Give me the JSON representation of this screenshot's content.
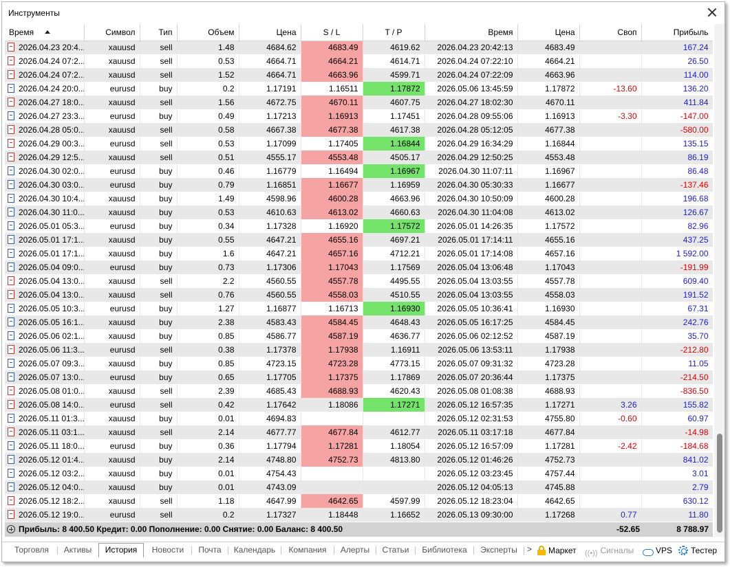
{
  "window": {
    "title": "Инструменты"
  },
  "columns": [
    "Время",
    "Символ",
    "Тип",
    "Объем",
    "Цена",
    "S / L",
    "T / P",
    "Время",
    "Цена",
    "Своп",
    "Прибыль"
  ],
  "rows": [
    {
      "open_time": "2026.04.23 20:4...",
      "symbol": "xauusd",
      "type": "sell",
      "volume": "1.48",
      "price": "4684.62",
      "sl": "4683.49",
      "tp": "4619.62",
      "close_time": "2026.04.23 20:42:13",
      "close_price": "4683.49",
      "swap": "",
      "profit": "167.24",
      "hit": "sl"
    },
    {
      "open_time": "2026.04.24 07:2...",
      "symbol": "xauusd",
      "type": "sell",
      "volume": "0.53",
      "price": "4664.71",
      "sl": "4664.21",
      "tp": "4614.71",
      "close_time": "2026.04.24 07:22:10",
      "close_price": "4664.21",
      "swap": "",
      "profit": "26.50",
      "hit": "sl"
    },
    {
      "open_time": "2026.04.24 07:2...",
      "symbol": "xauusd",
      "type": "sell",
      "volume": "1.52",
      "price": "4664.71",
      "sl": "4663.96",
      "tp": "4599.71",
      "close_time": "2026.04.24 07:22:09",
      "close_price": "4663.96",
      "swap": "",
      "profit": "114.00",
      "hit": "sl"
    },
    {
      "open_time": "2026.04.24 20:0...",
      "symbol": "eurusd",
      "type": "buy",
      "volume": "0.2",
      "price": "1.17191",
      "sl": "1.16511",
      "tp": "1.17872",
      "close_time": "2026.05.06 13:45:59",
      "close_price": "1.17872",
      "swap": "-13.60",
      "profit": "136.20",
      "hit": "tp"
    },
    {
      "open_time": "2026.04.27 18:0...",
      "symbol": "xauusd",
      "type": "sell",
      "volume": "1.56",
      "price": "4672.75",
      "sl": "4670.11",
      "tp": "4607.75",
      "close_time": "2026.04.27 18:02:30",
      "close_price": "4670.11",
      "swap": "",
      "profit": "411.84",
      "hit": "sl"
    },
    {
      "open_time": "2026.04.27 23:3...",
      "symbol": "eurusd",
      "type": "buy",
      "volume": "0.49",
      "price": "1.17213",
      "sl": "1.16913",
      "tp": "1.17451",
      "close_time": "2026.04.28 09:55:06",
      "close_price": "1.16913",
      "swap": "-3.30",
      "profit": "-147.00",
      "hit": "sl"
    },
    {
      "open_time": "2026.04.28 05:0...",
      "symbol": "xauusd",
      "type": "sell",
      "volume": "0.58",
      "price": "4667.38",
      "sl": "4677.38",
      "tp": "4617.38",
      "close_time": "2026.04.28 05:12:05",
      "close_price": "4677.38",
      "swap": "",
      "profit": "-580.00",
      "hit": "sl"
    },
    {
      "open_time": "2026.04.29 00:3...",
      "symbol": "eurusd",
      "type": "sell",
      "volume": "0.53",
      "price": "1.17099",
      "sl": "1.17405",
      "tp": "1.16844",
      "close_time": "2026.04.29 16:34:29",
      "close_price": "1.16844",
      "swap": "",
      "profit": "135.15",
      "hit": "tp"
    },
    {
      "open_time": "2026.04.29 12:5...",
      "symbol": "xauusd",
      "type": "sell",
      "volume": "0.51",
      "price": "4555.17",
      "sl": "4553.48",
      "tp": "4505.17",
      "close_time": "2026.04.29 12:50:25",
      "close_price": "4553.48",
      "swap": "",
      "profit": "86.19",
      "hit": "sl"
    },
    {
      "open_time": "2026.04.30 02:0...",
      "symbol": "eurusd",
      "type": "buy",
      "volume": "0.46",
      "price": "1.16779",
      "sl": "1.16494",
      "tp": "1.16967",
      "close_time": "2026.04.30 11:07:11",
      "close_price": "1.16967",
      "swap": "",
      "profit": "86.48",
      "hit": "tp"
    },
    {
      "open_time": "2026.04.30 03:0...",
      "symbol": "eurusd",
      "type": "buy",
      "volume": "0.79",
      "price": "1.16851",
      "sl": "1.16677",
      "tp": "1.16959",
      "close_time": "2026.04.30 05:30:33",
      "close_price": "1.16677",
      "swap": "",
      "profit": "-137.46",
      "hit": "sl"
    },
    {
      "open_time": "2026.04.30 10:4...",
      "symbol": "xauusd",
      "type": "buy",
      "volume": "1.49",
      "price": "4598.96",
      "sl": "4600.28",
      "tp": "4663.96",
      "close_time": "2026.04.30 10:50:09",
      "close_price": "4600.28",
      "swap": "",
      "profit": "196.68",
      "hit": "sl"
    },
    {
      "open_time": "2026.04.30 11:0...",
      "symbol": "xauusd",
      "type": "buy",
      "volume": "0.53",
      "price": "4610.63",
      "sl": "4613.02",
      "tp": "4660.63",
      "close_time": "2026.04.30 11:04:08",
      "close_price": "4613.02",
      "swap": "",
      "profit": "126.67",
      "hit": "sl"
    },
    {
      "open_time": "2026.05.01 05:3...",
      "symbol": "eurusd",
      "type": "buy",
      "volume": "0.34",
      "price": "1.17328",
      "sl": "1.16920",
      "tp": "1.17572",
      "close_time": "2026.05.01 14:26:35",
      "close_price": "1.17572",
      "swap": "",
      "profit": "82.96",
      "hit": "tp"
    },
    {
      "open_time": "2026.05.01 17:1...",
      "symbol": "xauusd",
      "type": "buy",
      "volume": "0.55",
      "price": "4647.21",
      "sl": "4655.16",
      "tp": "4697.21",
      "close_time": "2026.05.01 17:14:11",
      "close_price": "4655.16",
      "swap": "",
      "profit": "437.25",
      "hit": "sl"
    },
    {
      "open_time": "2026.05.01 17:1...",
      "symbol": "xauusd",
      "type": "buy",
      "volume": "1.6",
      "price": "4647.21",
      "sl": "4657.16",
      "tp": "4712.21",
      "close_time": "2026.05.01 17:14:08",
      "close_price": "4657.16",
      "swap": "",
      "profit": "1 592.00",
      "hit": "sl"
    },
    {
      "open_time": "2026.05.04 09:0...",
      "symbol": "eurusd",
      "type": "buy",
      "volume": "0.73",
      "price": "1.17306",
      "sl": "1.17043",
      "tp": "1.17569",
      "close_time": "2026.05.04 13:06:48",
      "close_price": "1.17043",
      "swap": "",
      "profit": "-191.99",
      "hit": "sl"
    },
    {
      "open_time": "2026.05.04 13:0...",
      "symbol": "xauusd",
      "type": "sell",
      "volume": "2.2",
      "price": "4560.55",
      "sl": "4557.78",
      "tp": "4495.55",
      "close_time": "2026.05.04 13:03:55",
      "close_price": "4557.78",
      "swap": "",
      "profit": "609.40",
      "hit": "sl"
    },
    {
      "open_time": "2026.05.04 13:0...",
      "symbol": "xauusd",
      "type": "sell",
      "volume": "0.76",
      "price": "4560.55",
      "sl": "4558.03",
      "tp": "4510.55",
      "close_time": "2026.05.04 13:03:55",
      "close_price": "4558.03",
      "swap": "",
      "profit": "191.52",
      "hit": "sl"
    },
    {
      "open_time": "2026.05.05 10:3...",
      "symbol": "eurusd",
      "type": "buy",
      "volume": "1.27",
      "price": "1.16877",
      "sl": "1.16713",
      "tp": "1.16930",
      "close_time": "2026.05.05 10:36:41",
      "close_price": "1.16930",
      "swap": "",
      "profit": "67.31",
      "hit": "tp"
    },
    {
      "open_time": "2026.05.05 16:1...",
      "symbol": "xauusd",
      "type": "buy",
      "volume": "2.38",
      "price": "4583.43",
      "sl": "4584.45",
      "tp": "4648.43",
      "close_time": "2026.05.05 16:17:25",
      "close_price": "4584.45",
      "swap": "",
      "profit": "242.76",
      "hit": "sl"
    },
    {
      "open_time": "2026.05.06 02:1...",
      "symbol": "xauusd",
      "type": "buy",
      "volume": "0.85",
      "price": "4586.77",
      "sl": "4587.19",
      "tp": "4636.77",
      "close_time": "2026.05.06 02:12:52",
      "close_price": "4587.19",
      "swap": "",
      "profit": "35.70",
      "hit": "sl"
    },
    {
      "open_time": "2026.05.06 11:3...",
      "symbol": "eurusd",
      "type": "sell",
      "volume": "0.38",
      "price": "1.17378",
      "sl": "1.17938",
      "tp": "1.16911",
      "close_time": "2026.05.06 13:53:11",
      "close_price": "1.17938",
      "swap": "",
      "profit": "-212.80",
      "hit": "sl"
    },
    {
      "open_time": "2026.05.07 09:3...",
      "symbol": "xauusd",
      "type": "buy",
      "volume": "0.85",
      "price": "4723.15",
      "sl": "4723.28",
      "tp": "4773.15",
      "close_time": "2026.05.07 09:31:32",
      "close_price": "4723.28",
      "swap": "",
      "profit": "11.05",
      "hit": "sl"
    },
    {
      "open_time": "2026.05.07 13:0...",
      "symbol": "eurusd",
      "type": "buy",
      "volume": "0.65",
      "price": "1.17705",
      "sl": "1.17375",
      "tp": "1.17869",
      "close_time": "2026.05.07 20:36:44",
      "close_price": "1.17375",
      "swap": "",
      "profit": "-214.50",
      "hit": "sl"
    },
    {
      "open_time": "2026.05.08 01:0...",
      "symbol": "xauusd",
      "type": "sell",
      "volume": "2.39",
      "price": "4685.43",
      "sl": "4688.93",
      "tp": "4620.43",
      "close_time": "2026.05.08 01:08:38",
      "close_price": "4688.93",
      "swap": "",
      "profit": "-836.50",
      "hit": "sl"
    },
    {
      "open_time": "2026.05.08 14:0...",
      "symbol": "eurusd",
      "type": "sell",
      "volume": "0.42",
      "price": "1.17642",
      "sl": "1.18086",
      "tp": "1.17271",
      "close_time": "2026.05.12 16:57:35",
      "close_price": "1.17271",
      "swap": "3.26",
      "profit": "155.82",
      "hit": "tp"
    },
    {
      "open_time": "2026.05.11 01:3...",
      "symbol": "xauusd",
      "type": "buy",
      "volume": "0.01",
      "price": "4694.83",
      "sl": "",
      "tp": "",
      "close_time": "2026.05.12 02:31:53",
      "close_price": "4755.80",
      "swap": "-0.60",
      "profit": "60.97",
      "hit": ""
    },
    {
      "open_time": "2026.05.11 03:1...",
      "symbol": "xauusd",
      "type": "sell",
      "volume": "2.14",
      "price": "4677.77",
      "sl": "4677.84",
      "tp": "4612.77",
      "close_time": "2026.05.11 03:17:18",
      "close_price": "4677.84",
      "swap": "",
      "profit": "-14.98",
      "hit": "sl"
    },
    {
      "open_time": "2026.05.11 18:0...",
      "symbol": "eurusd",
      "type": "buy",
      "volume": "0.36",
      "price": "1.17794",
      "sl": "1.17281",
      "tp": "1.18054",
      "close_time": "2026.05.12 16:57:09",
      "close_price": "1.17281",
      "swap": "-2.42",
      "profit": "-184.68",
      "hit": "sl"
    },
    {
      "open_time": "2026.05.12 01:4...",
      "symbol": "xauusd",
      "type": "buy",
      "volume": "2.14",
      "price": "4748.80",
      "sl": "4752.73",
      "tp": "4813.80",
      "close_time": "2026.05.12 01:46:26",
      "close_price": "4752.73",
      "swap": "",
      "profit": "841.02",
      "hit": "sl"
    },
    {
      "open_time": "2026.05.12 03:2...",
      "symbol": "xauusd",
      "type": "buy",
      "volume": "0.01",
      "price": "4754.43",
      "sl": "",
      "tp": "",
      "close_time": "2026.05.12 03:23:45",
      "close_price": "4757.44",
      "swap": "",
      "profit": "3.01",
      "hit": ""
    },
    {
      "open_time": "2026.05.12 04:0...",
      "symbol": "xauusd",
      "type": "buy",
      "volume": "0.01",
      "price": "4743.09",
      "sl": "",
      "tp": "",
      "close_time": "2026.05.12 04:05:13",
      "close_price": "4745.88",
      "swap": "",
      "profit": "2.79",
      "hit": ""
    },
    {
      "open_time": "2026.05.12 18:2...",
      "symbol": "xauusd",
      "type": "sell",
      "volume": "1.18",
      "price": "4647.99",
      "sl": "4642.65",
      "tp": "4597.99",
      "close_time": "2026.05.12 18:23:04",
      "close_price": "4642.65",
      "swap": "",
      "profit": "630.12",
      "hit": "sl"
    },
    {
      "open_time": "2026.05.12 19:0...",
      "symbol": "eurusd",
      "type": "sell",
      "volume": "0.2",
      "price": "1.17327",
      "sl": "1.18448",
      "tp": "1.16652",
      "close_time": "2026.05.13 09:30:00",
      "close_price": "1.17268",
      "swap": "0.77",
      "profit": "11.80",
      "hit": ""
    }
  ],
  "summary": {
    "text": "Прибыль: 8 400.50  Кредит: 0.00  Пополнение: 0.00  Снятие: 0.00  Баланс: 8 400.50",
    "swap": "-52.65",
    "profit": "8 788.97"
  },
  "tabs": [
    "Торговля",
    "Активы",
    "История",
    "Новости",
    "Почта",
    "Календарь",
    "Компания",
    "Алерты",
    "Статьи",
    "Библиотека",
    "Эксперты"
  ],
  "active_tab": "История",
  "tabs_more": ">",
  "side_buttons": {
    "market": "Маркет",
    "signals": "Сигналы",
    "signals_icon": "((•))",
    "vps": "VPS",
    "tester": "Тестер"
  },
  "colors": {
    "sl_hit": "#f5a3a3",
    "tp_hit": "#74e36a",
    "negative": "#e00000",
    "positive": "#1a1adc",
    "row_alt": "#e8e8e8"
  },
  "icons": {
    "deal_sell": "sell-deal-icon",
    "deal_buy": "buy-deal-icon",
    "summary": "expand-plus-icon",
    "market": "lock-icon",
    "signals": "signal-icon",
    "vps": "cloud-icon",
    "tester": "gear-icon",
    "close": "close-icon"
  }
}
